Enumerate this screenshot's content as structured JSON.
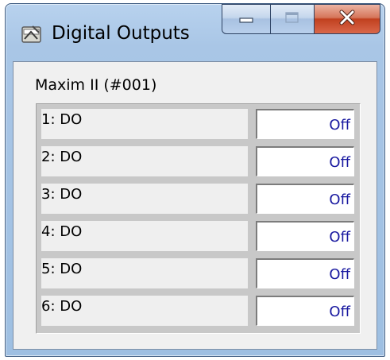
{
  "window": {
    "title": "Digital Outputs",
    "icon": "app-window-icon",
    "buttons": {
      "minimize": "minimize-icon",
      "maximize": "maximize-icon",
      "close": "close-icon"
    }
  },
  "device": {
    "label": "Maxim II (#001)"
  },
  "outputs": [
    {
      "label": "1: DO",
      "value": "Off"
    },
    {
      "label": "2: DO",
      "value": "Off"
    },
    {
      "label": "3: DO",
      "value": "Off"
    },
    {
      "label": "4: DO",
      "value": "Off"
    },
    {
      "label": "5: DO",
      "value": "Off"
    },
    {
      "label": "6: DO",
      "value": "Off"
    }
  ],
  "colors": {
    "value_text": "#1a1aa0",
    "close_button": "#c1401f",
    "frame": "#a9c6e6"
  }
}
